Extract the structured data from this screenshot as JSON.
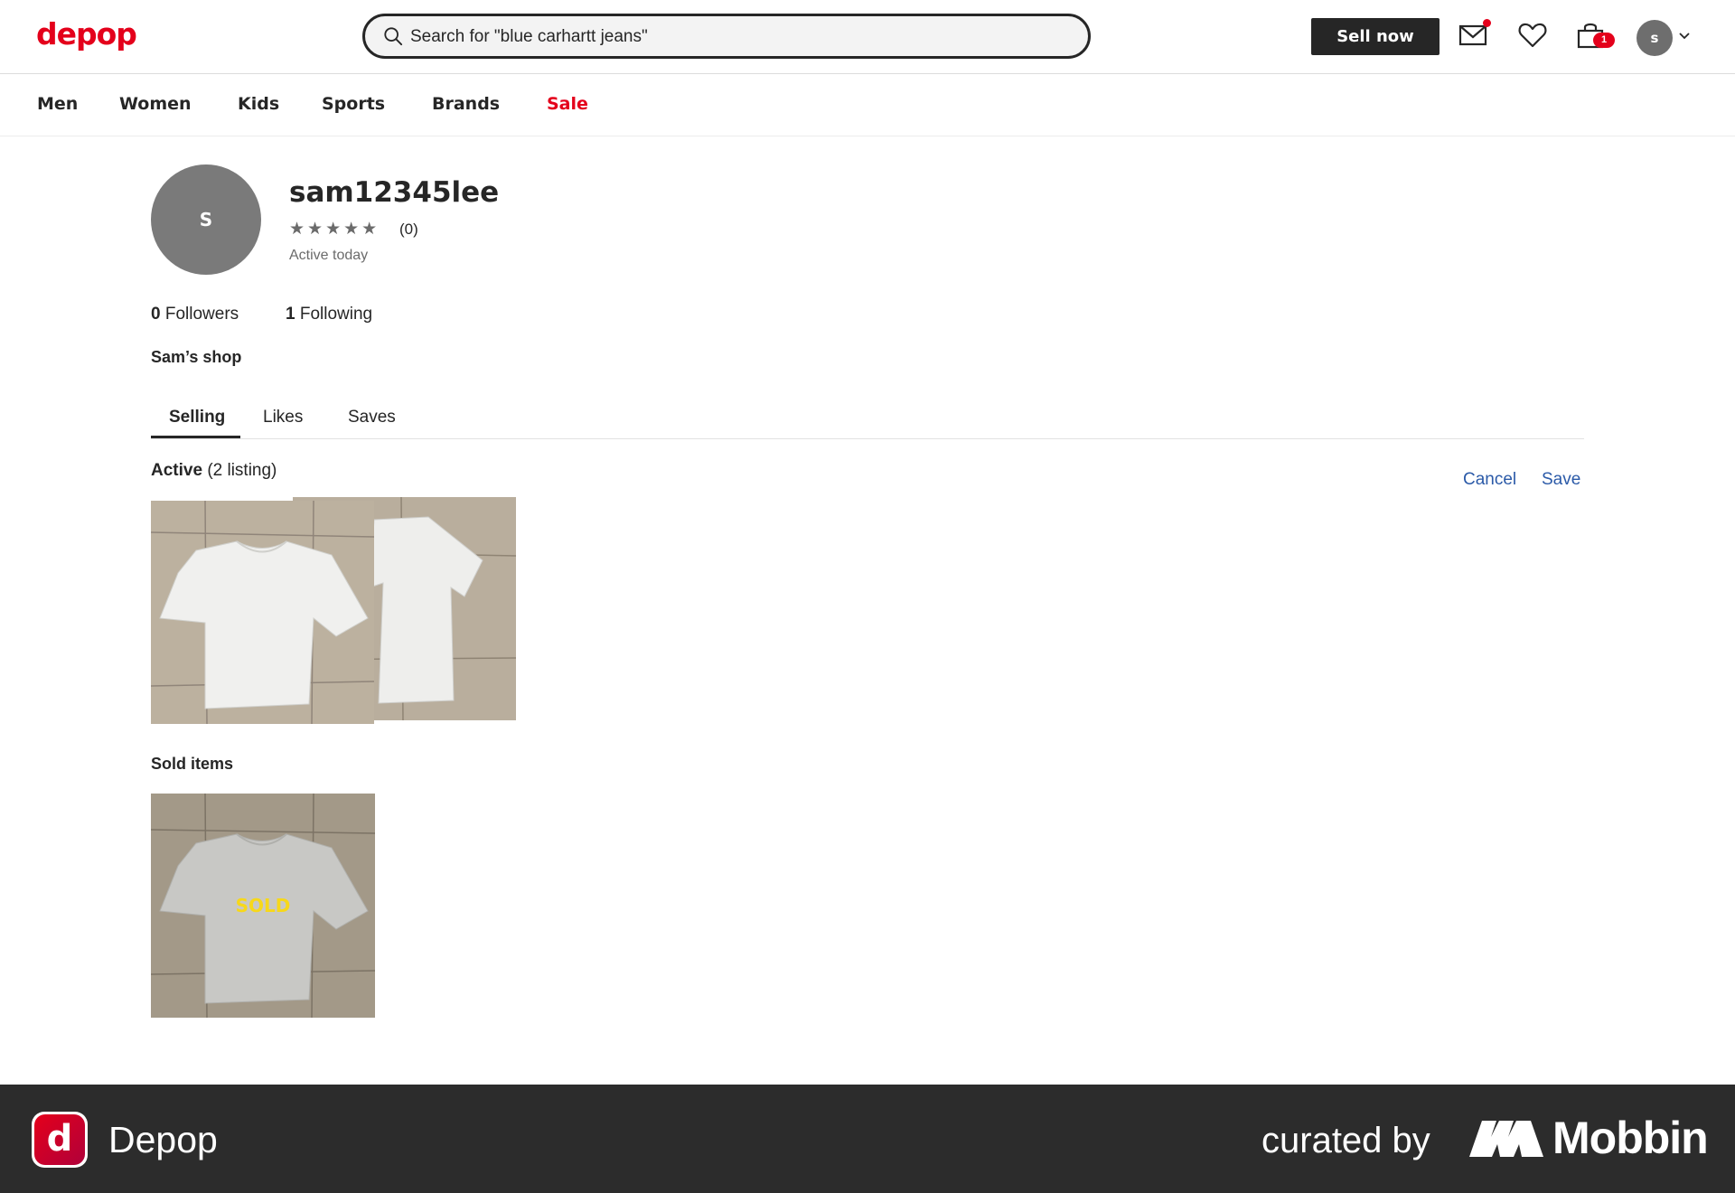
{
  "header": {
    "logo": "depop",
    "search_value": "Search for \"blue carhartt jeans\"",
    "sell_label": "Sell now",
    "cart_count": "1",
    "avatar_initial": "s"
  },
  "nav": {
    "items": [
      {
        "label": "Men"
      },
      {
        "label": "Women"
      },
      {
        "label": "Kids"
      },
      {
        "label": "Sports"
      },
      {
        "label": "Brands"
      },
      {
        "label": "Sale"
      }
    ]
  },
  "profile": {
    "avatar_initial": "S",
    "username": "sam12345lee",
    "stars": "★★★★★",
    "rating_count": "(0)",
    "activity": "Active today",
    "followers_count": "0",
    "followers_label": "Followers",
    "following_count": "1",
    "following_label": "Following",
    "shop_name": "Sam’s shop"
  },
  "tabs": [
    {
      "label": "Selling",
      "active": true
    },
    {
      "label": "Likes",
      "active": false
    },
    {
      "label": "Saves",
      "active": false
    }
  ],
  "listings": {
    "active_label": "Active",
    "active_count": "(2 listing)",
    "cancel_label": "Cancel",
    "save_label": "Save",
    "sold_heading": "Sold items",
    "sold_badge": "SOLD"
  },
  "footer": {
    "app_icon_letter": "d",
    "app_name": "Depop",
    "curated_by": "curated by",
    "brand": "Mobbin"
  },
  "colors": {
    "brand_red": "#e4001b",
    "link_blue": "#2b5aa8",
    "dark": "#262626",
    "sold_yellow": "#f7d81a"
  }
}
